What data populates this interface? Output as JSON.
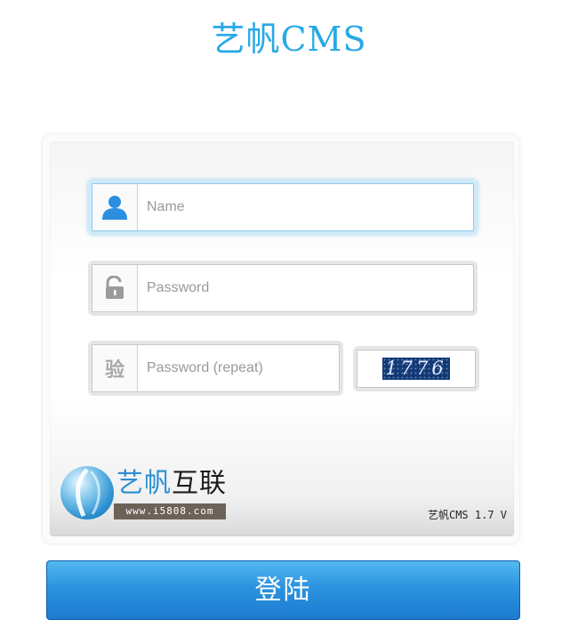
{
  "header": {
    "title": "艺帆CMS"
  },
  "form": {
    "name_placeholder": "Name",
    "password_placeholder": "Password",
    "verify_placeholder": "Password (repeat)",
    "verify_icon_text": "验",
    "captcha_text": "1776",
    "username_icon": "user-icon",
    "password_icon": "lock-open-icon"
  },
  "footer": {
    "logo_name_accent": "艺帆",
    "logo_name_rest": "互联",
    "logo_url": "www.i5808.com",
    "version": "艺帆CMS 1.7 V"
  },
  "actions": {
    "login_label": "登陆"
  },
  "colors": {
    "accent": "#28a9e6",
    "button": "#2a93e0",
    "active_field_glow": "#cfeaf8"
  }
}
